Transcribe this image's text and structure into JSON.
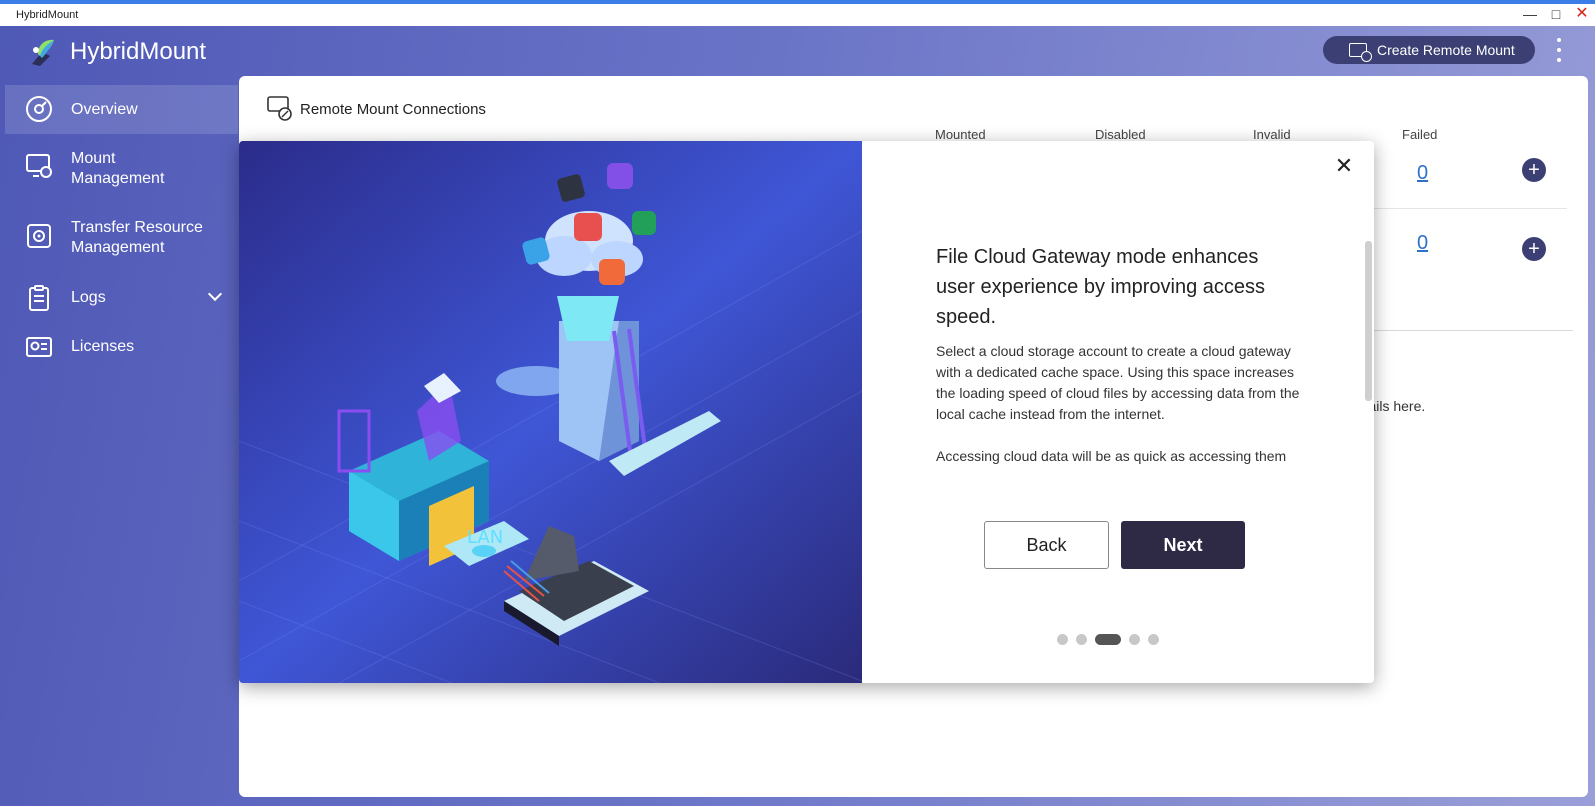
{
  "window": {
    "title": "HybridMount"
  },
  "app": {
    "name": "HybridMount",
    "create_button_label": "Create Remote Mount"
  },
  "sidebar": {
    "items": [
      {
        "label": "Overview",
        "icon": "overview-icon",
        "active": true
      },
      {
        "label": "Mount Management",
        "icon": "mount-management-icon"
      },
      {
        "label": "Transfer Resource Management",
        "icon": "transfer-resource-icon"
      },
      {
        "label": "Logs",
        "icon": "logs-icon",
        "expandable": true
      },
      {
        "label": "Licenses",
        "icon": "licenses-icon"
      }
    ]
  },
  "main": {
    "section_title": "Remote Mount Connections",
    "columns": [
      "Mounted",
      "Disabled",
      "Invalid",
      "Failed"
    ],
    "rows": [
      {
        "failed": "0"
      },
      {
        "failed": "0"
      }
    ],
    "details_text": "details here."
  },
  "modal": {
    "heading": "File Cloud Gateway mode enhances user experience by improving access speed.",
    "paragraphs": [
      "Select a cloud storage account to create a cloud gateway with a dedicated cache space. Using this space increases the loading speed of cloud files by accessing data from the local cache instead from the internet.",
      "Accessing cloud data will be as quick as accessing them locally. With local cache, you can:"
    ],
    "illustration_label": "LAN",
    "back_label": "Back",
    "next_label": "Next",
    "page_count": 5,
    "current_page": 3
  },
  "colors": {
    "accent": "#3b3f73",
    "next_button": "#2e2a45",
    "link": "#2e72c7"
  }
}
